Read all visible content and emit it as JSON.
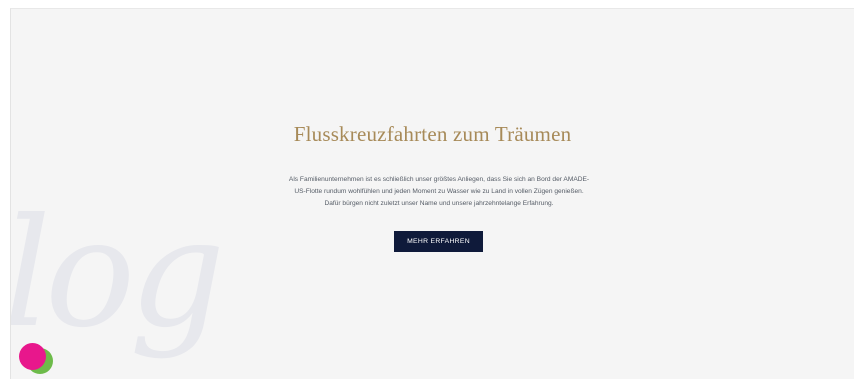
{
  "hero": {
    "background_script_text": "log",
    "title": "Flusskreuzfahrten zum Träumen",
    "paragraph_lines": [
      "Als Familienunternehmen ist es schließlich unser größtes Anliegen, dass Sie sich an Bord der AMADE-",
      "US-Flotte rundum wohlfühlen und jeden Moment zu Wasser wie zu Land in vollen Zügen genießen.",
      "Dafür bürgen nicht zuletzt unser Name und unsere jahrzehntelange Erfahrung."
    ],
    "cta_label": "MEHR ERFAHREN"
  },
  "chat_widget": {
    "icon": "chat-bubble-icon",
    "colors": {
      "primary": "#e8178c",
      "secondary": "#6dbb4a"
    }
  },
  "colors": {
    "title": "#a78a58",
    "button_bg": "#0f1a3a",
    "page_bg": "#f5f5f5"
  }
}
